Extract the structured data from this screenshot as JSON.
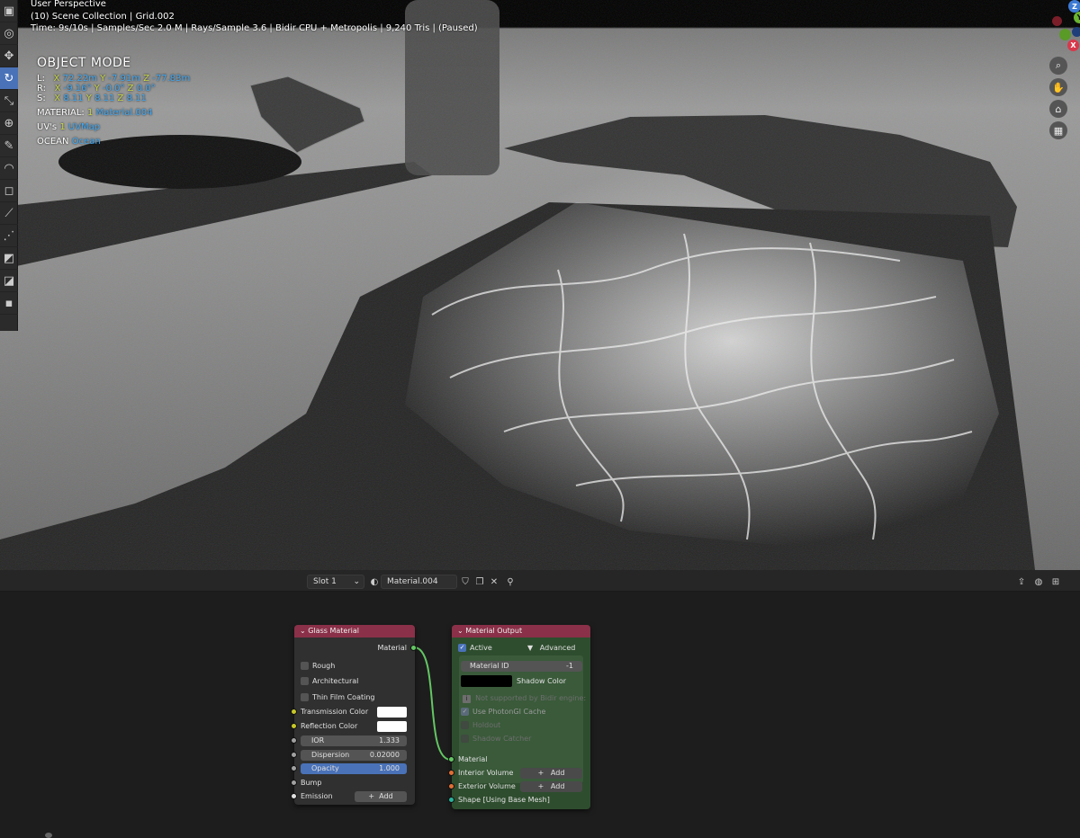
{
  "viewport": {
    "perspective": "User Perspective",
    "collection": "(10) Scene Collection | Grid.002",
    "stats": "Time: 9s/10s | Samples/Sec 2.0 M | Rays/Sample 3.6 | Bidir CPU + Metropolis | 9,240 Tris | (Paused)",
    "mode": "OBJECT MODE",
    "loc": {
      "label": "L:",
      "x": "72.22m",
      "y": "-7.91m",
      "z": "-77.83m"
    },
    "rot": {
      "label": "R:",
      "x": "-9.16°",
      "y": "-0.0°",
      "z": "0.0°"
    },
    "scale": {
      "label": "S:",
      "x": "8.11",
      "y": "8.11",
      "z": "8.11"
    },
    "material": {
      "label": "MATERIAL:",
      "count": "1",
      "name": "Material.004"
    },
    "uvs": {
      "label": "UV's",
      "count": "1",
      "name": "UVMap"
    },
    "ocean": {
      "label": "OCEAN",
      "name": "Ocean"
    },
    "axis_letters": {
      "x": "X",
      "y": "Y",
      "z": "Z"
    }
  },
  "node_header": {
    "slot": "Slot 1",
    "material_name": "Material.004"
  },
  "glass_node": {
    "title": "Glass Material",
    "output": "Material",
    "rough": "Rough",
    "architectural": "Architectural",
    "thin_film": "Thin Film Coating",
    "transmission": "Transmission Color",
    "reflection": "Reflection Color",
    "ior_label": "IOR",
    "ior_value": "1.333",
    "dispersion_label": "Dispersion",
    "dispersion_value": "0.02000",
    "opacity_label": "Opacity",
    "opacity_value": "1.000",
    "bump": "Bump",
    "emission": "Emission",
    "add": "Add"
  },
  "output_node": {
    "title": "Material Output",
    "active": "Active",
    "advanced": "Advanced",
    "material_id_label": "Material ID",
    "material_id_value": "-1",
    "shadow_color": "Shadow Color",
    "not_supported": "Not supported by Bidir engine:",
    "photongi": "Use PhotonGI Cache",
    "holdout": "Holdout",
    "shadow_catcher": "Shadow Catcher",
    "material_in": "Material",
    "interior": "Interior Volume",
    "exterior": "Exterior Volume",
    "shape": "Shape [Using Base Mesh]",
    "add": "Add"
  },
  "colors": {
    "node_header": "#8a3048",
    "output_body": "#2e4d2e",
    "socket_yellow": "#c7c729",
    "socket_gray": "#a1a1a1",
    "socket_green": "#63c763",
    "socket_orange": "#e06f33",
    "socket_teal": "#29b39b",
    "accent_blue": "#4a72b8"
  }
}
